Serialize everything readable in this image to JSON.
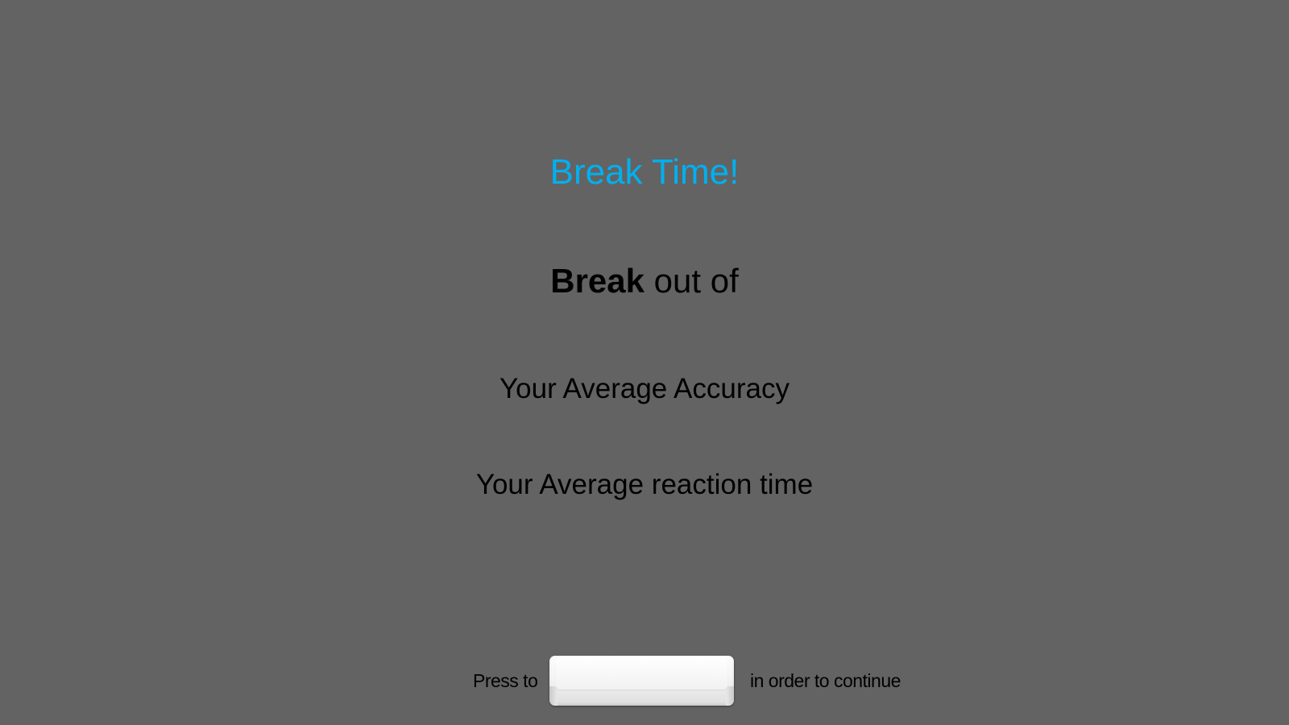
{
  "screen": {
    "background_color": "#636363",
    "title": "Break Time!",
    "title_color": "#00b0f0",
    "block_info": {
      "bold_word": "Break",
      "rest": " out of"
    },
    "accuracy_label": "Your Average Accuracy",
    "reaction_label": "Your Average reaction time"
  },
  "footer": {
    "press_text": "Press to",
    "key_icon": "spacebar-key-icon",
    "key_label": "",
    "continue_text": "in order to continue"
  }
}
